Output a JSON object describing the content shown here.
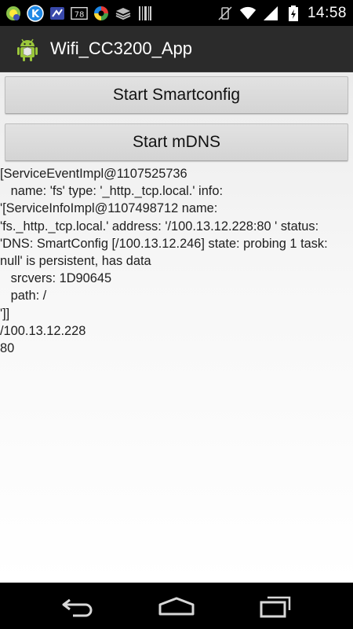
{
  "status_bar": {
    "time": "14:58",
    "notification_badge": "78",
    "left_icons": [
      "notification-app-icon",
      "k-app-icon",
      "map-app-icon",
      "badge-78-icon",
      "color-app-icon",
      "layers-icon",
      "barcode-icon"
    ],
    "right_icons": [
      "vibrate-mute-icon",
      "wifi-icon",
      "signal-icon",
      "battery-icon"
    ]
  },
  "action_bar": {
    "title": "Wifi_CC3200_App",
    "icon": "android-icon"
  },
  "buttons": {
    "smartconfig_label": "Start Smartconfig",
    "mdns_label": "Start mDNS"
  },
  "log": {
    "text": "[ServiceEventImpl@1107525736\n   name: 'fs' type: '_http._tcp.local.' info:\n'[ServiceInfoImpl@1107498712 name:\n'fs._http._tcp.local.' address: '/100.13.12.228:80 ' status:\n'DNS: SmartConfig [/100.13.12.246] state: probing 1 task:\nnull' is persistent, has data\n   srcvers: 1D90645\n   path: /\n']]\n/100.13.12.228\n80"
  },
  "nav_bar": {
    "icons": [
      "back-icon",
      "home-icon",
      "recent-apps-icon"
    ]
  },
  "colors": {
    "status_bar": "#000000",
    "action_bar": "#2b2b2b",
    "button": "#d8d8d8",
    "content_bg": "#f3f3f3"
  }
}
